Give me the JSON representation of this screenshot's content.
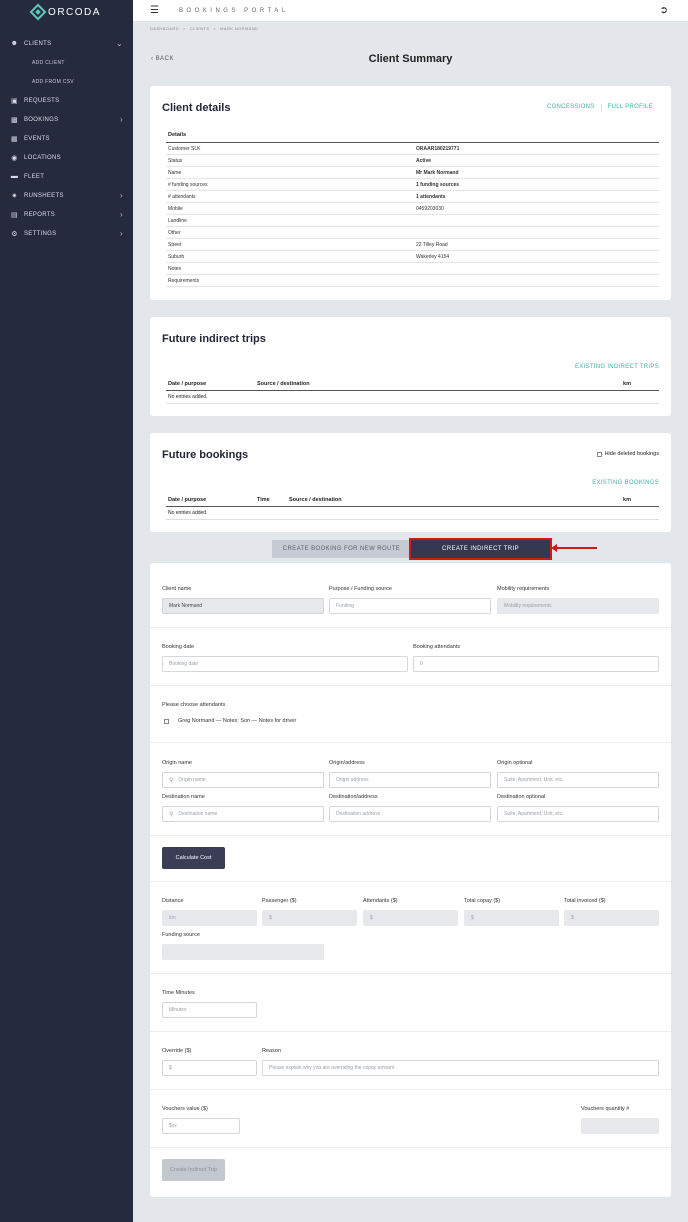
{
  "brand": "ORCODA",
  "portal_title": "BOOKINGS PORTAL",
  "breadcrumb": [
    "DASHBOARD",
    "CLIENTS",
    "MARK NORMAND"
  ],
  "sidebar": {
    "items": [
      {
        "label": "CLIENTS",
        "icon": "users-icon"
      },
      {
        "label": "ADD CLIENT"
      },
      {
        "label": "ADD FROM CSV"
      },
      {
        "label": "REQUESTS",
        "icon": "clipboard-icon"
      },
      {
        "label": "BOOKINGS",
        "icon": "book-icon"
      },
      {
        "label": "EVENTS",
        "icon": "calendar-icon"
      },
      {
        "label": "LOCATIONS",
        "icon": "map-pin-icon"
      },
      {
        "label": "FLEET",
        "icon": "car-icon"
      },
      {
        "label": "RUNSHEETS",
        "icon": "runner-icon"
      },
      {
        "label": "REPORTS",
        "icon": "file-icon"
      },
      {
        "label": "SETTINGS",
        "icon": "gear-icon"
      }
    ]
  },
  "back_label": "BACK",
  "page_title": "Client Summary",
  "client_details": {
    "title": "Client details",
    "concessions": "CONCESSIONS",
    "full_profile": "FULL PROFILE",
    "table_header": "Details",
    "rows": [
      {
        "label": "Customer SLK",
        "value": "ORAAR180219771"
      },
      {
        "label": "Status",
        "value": "Active"
      },
      {
        "label": "Name",
        "value": "Mr Mark Normand"
      },
      {
        "label": "# funding sources",
        "value": "1 funding sources"
      },
      {
        "label": "# attendants",
        "value": "1 attendants"
      },
      {
        "label": "Mobile",
        "value": "0459203030"
      },
      {
        "label": "Landline",
        "value": ""
      },
      {
        "label": "Other",
        "value": ""
      },
      {
        "label": "Street",
        "value": "22 Tilley Road"
      },
      {
        "label": "Suburb",
        "value": "Wakerley 4154"
      },
      {
        "label": "Notes",
        "value": ""
      },
      {
        "label": "Requirements",
        "value": ""
      }
    ]
  },
  "indirect_trips": {
    "title": "Future indirect trips",
    "link": "EXISTING INDIRECT TRIPS",
    "columns": [
      "Date / purpose",
      "Source / destination",
      "km"
    ],
    "empty": "No entries added."
  },
  "future_bookings": {
    "title": "Future bookings",
    "hide_deleted": "Hide deleted bookings",
    "link": "EXISTING BOOKINGS",
    "columns": [
      "Date / purpose",
      "Time",
      "Source / destination",
      "km"
    ],
    "empty": "No entries added."
  },
  "tabs": {
    "new_route": "CREATE BOOKING FOR NEW ROUTE",
    "indirect": "CREATE INDIRECT TRIP"
  },
  "form": {
    "client_name_label": "Client name",
    "client_name_value": "Mark Normand",
    "purpose_label": "Purpose / Funding source",
    "purpose_placeholder": "Funding",
    "mobility_label": "Mobility requirements",
    "mobility_placeholder": "Mobility requirements",
    "booking_date_label": "Booking date",
    "booking_date_placeholder": "Booking date",
    "attendants_label": "Booking attendants",
    "attendants_value": "0",
    "choose_attendants": "Please choose attendants",
    "attendant_option": "Greg Normand — Notes: Son — Notes for driver",
    "origin_name_label": "Origin name",
    "origin_name_placeholder": "Origin name",
    "origin_address_label": "Origin/address",
    "origin_address_placeholder": "Origin address",
    "origin_optional_label": "Origin optional",
    "origin_optional_placeholder": "Suite, Apartment, Unit, etc.",
    "dest_name_label": "Destination name",
    "dest_name_placeholder": "Destination name",
    "dest_address_label": "Destination/address",
    "dest_address_placeholder": "Destination address",
    "dest_optional_label": "Destination optional",
    "dest_optional_placeholder": "Suite, Apartment, Unit, etc.",
    "calc_button": "Calculate Cost",
    "distance_label": "Distance",
    "distance_placeholder": "km",
    "passenger_label": "Passenger ($)",
    "passenger_placeholder": "$",
    "attendants_cost_label": "Attendants ($)",
    "attendants_cost_placeholder": "$",
    "copay_label": "Total copay ($)",
    "copay_placeholder": "$",
    "invoiced_label": "Total invoiced ($)",
    "invoiced_placeholder": "$",
    "funding_source_label": "Funding source",
    "time_minutes_label": "Time Minutes",
    "time_minutes_placeholder": "Minutes",
    "override_label": "Override ($)",
    "override_placeholder": "$",
    "reason_label": "Reason",
    "reason_placeholder": "Please explain why you are overriding the copay amount",
    "vouchers_value_label": "Vouchers value ($)",
    "vouchers_value_placeholder": "$xx",
    "vouchers_qty_label": "Vouchers quantity #",
    "submit_button": "Create Indirect Trip"
  },
  "colors": {
    "sidebar": "#262a3d",
    "accent_teal": "#3fb3a3",
    "primary_button": "#343850",
    "highlight_red": "#d01a1a"
  }
}
